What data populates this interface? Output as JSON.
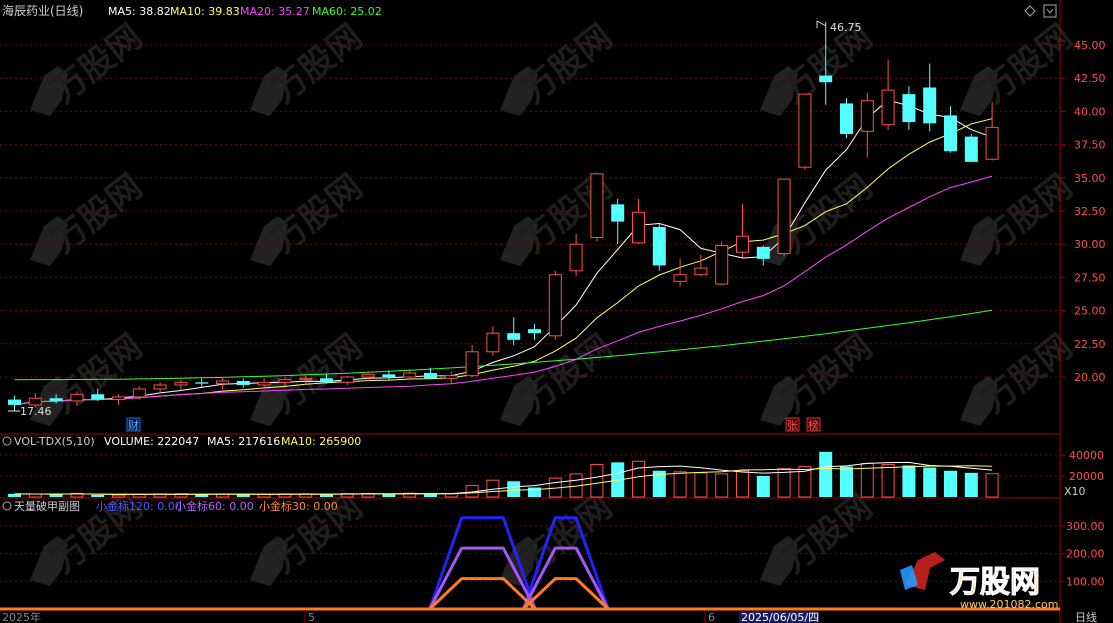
{
  "header": {
    "stock": "海辰药业(日线)",
    "ma5": "MA5: 38.82",
    "ma10": "MA10: 39.83",
    "ma20": "MA20: 35.27",
    "ma60": "MA60: 25.02"
  },
  "volume_header": {
    "indicator": "VOL-TDX(5,10)",
    "volume": "VOLUME: 222047",
    "ma5": "MA5: 217616",
    "ma10": "MA10: 265900"
  },
  "sub_header": {
    "indicator": "天量破甲副图",
    "item1": "小金标120: 0.00",
    "item2": "小金标60: 0.00",
    "item3": "小金标30: 0.00"
  },
  "markers": {
    "fin": "财",
    "zhang": "张",
    "bang": "榜"
  },
  "bottom_axis": {
    "label1": "2025年",
    "label2": "5",
    "label3": "6",
    "cursor_date": "2025/06/05/四",
    "period": "日线"
  },
  "volume_scale_unit": "X10",
  "logo": {
    "brand": "万股网",
    "url": "www.201082.com"
  },
  "watermark": "万股网",
  "colors": {
    "up": "#ff4d4d",
    "down": "#54ffff",
    "ma5": "#ffffff",
    "ma10": "#ffff66",
    "ma20": "#ff44ff",
    "ma60": "#33ff33",
    "grid": "#7a0000",
    "axis": "#a00000"
  },
  "chart_data": [
    {
      "type": "candlestick",
      "title": "海辰药业(日线)",
      "ylim": [
        17.0,
        46.5
      ],
      "y_ticks": [
        "20.00",
        "22.50",
        "25.00",
        "27.50",
        "30.00",
        "32.50",
        "35.00",
        "37.50",
        "40.00",
        "42.50",
        "45.00"
      ],
      "annotations": {
        "high": "46.75",
        "low": "17.46"
      },
      "candles": [
        {
          "o": 18.3,
          "h": 18.6,
          "l": 17.46,
          "c": 17.9
        },
        {
          "o": 17.9,
          "h": 18.8,
          "l": 17.7,
          "c": 18.4
        },
        {
          "o": 18.4,
          "h": 18.7,
          "l": 18.0,
          "c": 18.2
        },
        {
          "o": 18.2,
          "h": 18.9,
          "l": 17.8,
          "c": 18.7
        },
        {
          "o": 18.7,
          "h": 19.1,
          "l": 18.2,
          "c": 18.3
        },
        {
          "o": 18.3,
          "h": 18.7,
          "l": 17.9,
          "c": 18.5
        },
        {
          "o": 18.5,
          "h": 19.3,
          "l": 18.3,
          "c": 19.1
        },
        {
          "o": 19.1,
          "h": 19.6,
          "l": 18.8,
          "c": 19.4
        },
        {
          "o": 19.4,
          "h": 19.8,
          "l": 19.0,
          "c": 19.6
        },
        {
          "o": 19.6,
          "h": 19.9,
          "l": 19.2,
          "c": 19.5
        },
        {
          "o": 19.5,
          "h": 20.0,
          "l": 19.1,
          "c": 19.7
        },
        {
          "o": 19.7,
          "h": 19.9,
          "l": 19.2,
          "c": 19.4
        },
        {
          "o": 19.4,
          "h": 19.9,
          "l": 19.1,
          "c": 19.6
        },
        {
          "o": 19.6,
          "h": 20.0,
          "l": 19.3,
          "c": 19.8
        },
        {
          "o": 19.8,
          "h": 20.1,
          "l": 19.4,
          "c": 19.9
        },
        {
          "o": 19.9,
          "h": 20.2,
          "l": 19.5,
          "c": 19.6
        },
        {
          "o": 19.6,
          "h": 20.1,
          "l": 19.4,
          "c": 20.0
        },
        {
          "o": 20.0,
          "h": 20.4,
          "l": 19.7,
          "c": 20.2
        },
        {
          "o": 20.2,
          "h": 20.5,
          "l": 19.8,
          "c": 20.0
        },
        {
          "o": 20.0,
          "h": 20.6,
          "l": 19.8,
          "c": 20.3
        },
        {
          "o": 20.3,
          "h": 20.7,
          "l": 19.9,
          "c": 19.9
        },
        {
          "o": 19.9,
          "h": 20.4,
          "l": 19.5,
          "c": 20.1
        },
        {
          "o": 20.1,
          "h": 22.4,
          "l": 20.0,
          "c": 21.9
        },
        {
          "o": 21.9,
          "h": 23.8,
          "l": 21.6,
          "c": 23.3
        },
        {
          "o": 23.3,
          "h": 24.5,
          "l": 22.4,
          "c": 22.8
        },
        {
          "o": 23.6,
          "h": 24.0,
          "l": 22.8,
          "c": 23.3
        },
        {
          "o": 23.1,
          "h": 28.0,
          "l": 22.8,
          "c": 27.7
        },
        {
          "o": 28.0,
          "h": 30.8,
          "l": 27.6,
          "c": 30.0
        },
        {
          "o": 30.5,
          "h": 35.3,
          "l": 30.2,
          "c": 35.3
        },
        {
          "o": 33.0,
          "h": 33.4,
          "l": 30.0,
          "c": 31.7
        },
        {
          "o": 30.1,
          "h": 33.4,
          "l": 30.0,
          "c": 32.4
        },
        {
          "o": 31.3,
          "h": 31.5,
          "l": 28.0,
          "c": 28.4
        },
        {
          "o": 27.2,
          "h": 28.9,
          "l": 26.8,
          "c": 27.7
        },
        {
          "o": 27.7,
          "h": 29.2,
          "l": 27.6,
          "c": 28.2
        },
        {
          "o": 27.0,
          "h": 30.2,
          "l": 26.9,
          "c": 29.9
        },
        {
          "o": 29.4,
          "h": 33.0,
          "l": 29.0,
          "c": 30.6
        },
        {
          "o": 29.8,
          "h": 29.9,
          "l": 28.4,
          "c": 28.9
        },
        {
          "o": 29.3,
          "h": 34.9,
          "l": 29.1,
          "c": 34.9
        },
        {
          "o": 35.8,
          "h": 41.3,
          "l": 35.6,
          "c": 41.3
        },
        {
          "o": 42.7,
          "h": 46.75,
          "l": 40.5,
          "c": 42.2
        },
        {
          "o": 40.6,
          "h": 41.0,
          "l": 38.0,
          "c": 38.3
        },
        {
          "o": 38.5,
          "h": 41.4,
          "l": 36.5,
          "c": 40.8
        },
        {
          "o": 39.0,
          "h": 43.9,
          "l": 38.6,
          "c": 41.6
        },
        {
          "o": 41.3,
          "h": 41.9,
          "l": 38.6,
          "c": 39.2
        },
        {
          "o": 41.8,
          "h": 43.6,
          "l": 38.5,
          "c": 39.1
        },
        {
          "o": 39.7,
          "h": 40.4,
          "l": 36.9,
          "c": 37.0
        },
        {
          "o": 38.1,
          "h": 38.3,
          "l": 36.2,
          "c": 36.2
        },
        {
          "o": 36.4,
          "h": 40.7,
          "l": 36.3,
          "c": 38.8
        }
      ],
      "ma60_endpoints": {
        "start": 19.8,
        "end": 25.02
      }
    },
    {
      "type": "bar",
      "title": "VOL-TDX(5,10)",
      "y_ticks": [
        "20000",
        "40000"
      ],
      "unit": "X10",
      "values": [
        3000,
        2800,
        2500,
        3500,
        2000,
        1800,
        2600,
        2900,
        3100,
        2500,
        2700,
        2400,
        2600,
        2900,
        3000,
        2600,
        3300,
        3400,
        3100,
        3600,
        2900,
        3100,
        11000,
        16000,
        15000,
        9000,
        18000,
        22000,
        31000,
        33000,
        34000,
        25000,
        24000,
        23000,
        22000,
        25000,
        20000,
        27000,
        29000,
        43000,
        29000,
        32000,
        31000,
        30000,
        28000,
        25000,
        23000,
        22200
      ]
    },
    {
      "type": "line",
      "title": "天量破甲副图",
      "series_labels": [
        "小金标120",
        "小金标60",
        "小金标30"
      ],
      "y_ticks": [
        "100.00",
        "200.00",
        "300.00"
      ],
      "ylim": [
        0,
        360
      ],
      "series": [
        {
          "name": "小金标120",
          "peaks": [
            {
              "start": 21.5,
              "end": 23.5,
              "value": 330
            },
            {
              "start": 26,
              "end": 27,
              "value": 330
            }
          ]
        },
        {
          "name": "小金标60",
          "peaks": [
            {
              "start": 21.5,
              "end": 23.5,
              "value": 220
            },
            {
              "start": 26,
              "end": 27,
              "value": 220
            }
          ]
        },
        {
          "name": "小金标30",
          "peaks": [
            {
              "start": 21.5,
              "end": 23.5,
              "value": 110
            },
            {
              "start": 26,
              "end": 27,
              "value": 110
            }
          ]
        }
      ]
    }
  ]
}
